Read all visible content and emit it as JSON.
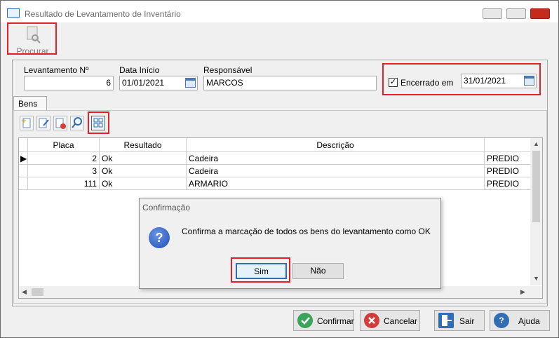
{
  "window": {
    "title": "Resultado de Levantamento de Inventário"
  },
  "toolbar": {
    "procurar_label": "Procurar"
  },
  "header": {
    "levantamento_label": "Levantamento Nº",
    "levantamento_value": "6",
    "data_inicio_label": "Data Início",
    "data_inicio_value": "01/01/2021",
    "responsavel_label": "Responsável",
    "responsavel_value": "MARCOS",
    "encerrado_label": "Encerrado em",
    "encerrado_checked": true,
    "encerrado_value": "31/01/2021"
  },
  "tabs": [
    {
      "label": "Bens"
    }
  ],
  "grid": {
    "columns": [
      "Placa",
      "Resultado",
      "Descrição",
      ""
    ],
    "rows": [
      {
        "placa": "2",
        "resultado": "Ok",
        "descricao": "Cadeira",
        "local": "PREDIO"
      },
      {
        "placa": "3",
        "resultado": "Ok",
        "descricao": "Cadeira",
        "local": "PREDIO"
      },
      {
        "placa": "111",
        "resultado": "Ok",
        "descricao": "ARMARIO",
        "local": "PREDIO"
      }
    ]
  },
  "dialog": {
    "title": "Confirmação",
    "message": "Confirma a marcação de todos os bens do levantamento como OK",
    "yes_label": "Sim",
    "no_label": "Não"
  },
  "buttons": {
    "confirmar_label": "Confirmar",
    "cancelar_label": "Cancelar",
    "sair_label": "Sair",
    "ajuda_label": "Ajuda"
  },
  "colors": {
    "highlight": "#e0202a",
    "accent": "#2f6db5"
  }
}
